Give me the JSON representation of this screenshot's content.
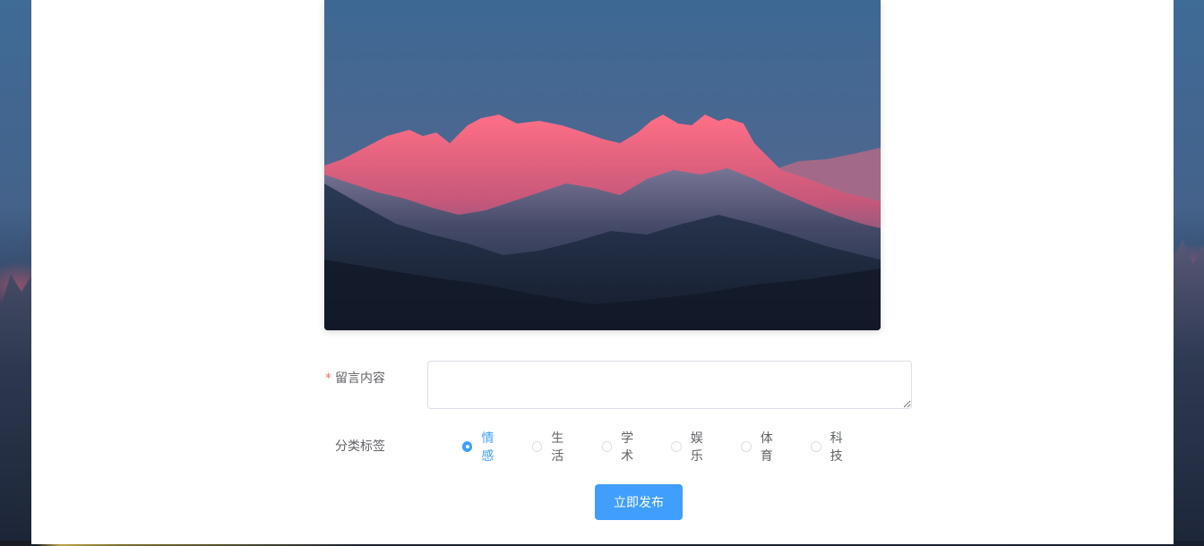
{
  "hero_image": {
    "icon": "mountain-image"
  },
  "form": {
    "content_field": {
      "required_mark": "*",
      "label": "留言内容",
      "value": "",
      "placeholder": ""
    },
    "tags_field": {
      "label": "分类标签",
      "options": [
        {
          "label": "情感",
          "checked": true
        },
        {
          "label": "生活",
          "checked": false
        },
        {
          "label": "学术",
          "checked": false
        },
        {
          "label": "娱乐",
          "checked": false
        },
        {
          "label": "体育",
          "checked": false
        },
        {
          "label": "科技",
          "checked": false
        }
      ]
    },
    "submit_label": "立即发布"
  },
  "colors": {
    "primary": "#409eff",
    "required": "#f56c6c",
    "label_text": "#606266",
    "border": "#dcdfe6"
  }
}
